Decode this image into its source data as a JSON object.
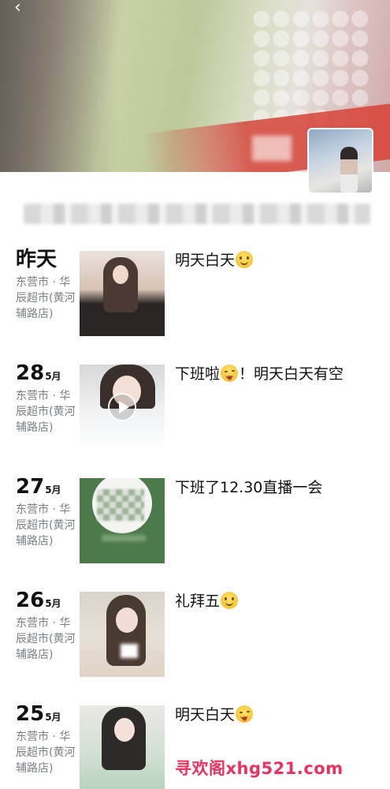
{
  "header": {
    "back_label": "‹",
    "cover_colors": {
      "accent_red": "#d6463c",
      "green": "#c9d0a6"
    }
  },
  "posts": [
    {
      "date_label": "昨天",
      "day": "",
      "month": "",
      "location": "东营市 · 华辰超市(黄河辅路店)",
      "caption": "明天白天",
      "emoji": "smile",
      "media": "photo"
    },
    {
      "date_label": "",
      "day": "28",
      "month": "5月",
      "location": "东营市 · 华辰超市(黄河辅路店)",
      "caption_before": "下班啦",
      "emoji": "wink-tongue",
      "caption_after": "！明天白天有空",
      "media": "video"
    },
    {
      "date_label": "",
      "day": "27",
      "month": "5月",
      "location": "东营市 · 华辰超市(黄河辅路店)",
      "caption": "下班了12.30直播一会",
      "emoji": "",
      "media": "photo"
    },
    {
      "date_label": "",
      "day": "26",
      "month": "5月",
      "location": "东营市 · 华辰超市(黄河辅路店)",
      "caption": "礼拜五",
      "emoji": "smile",
      "media": "photo"
    },
    {
      "date_label": "",
      "day": "25",
      "month": "5月",
      "location": "东营市 · 华辰超市(黄河辅路店)",
      "caption": "明天白天",
      "emoji": "wink-tongue",
      "media": "photo"
    }
  ],
  "watermark": "寻欢阁xhg521.com"
}
